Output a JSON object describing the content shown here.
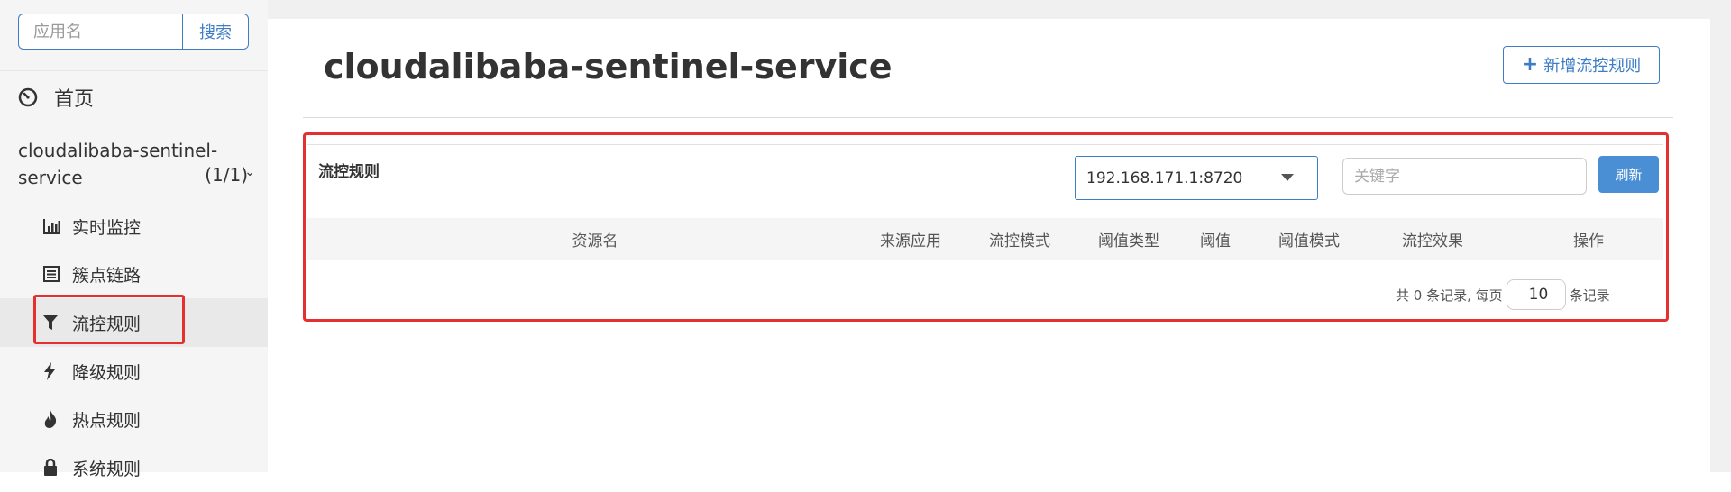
{
  "sidebar": {
    "search": {
      "placeholder": "应用名",
      "button_label": "搜索"
    },
    "home_label": "首页",
    "app": {
      "name": "cloudalibaba-sentinel-service",
      "count": "(1/1)"
    },
    "menu": [
      {
        "label": "实时监控",
        "icon": "bar-chart-icon"
      },
      {
        "label": "簇点链路",
        "icon": "list-icon"
      },
      {
        "label": "流控规则",
        "icon": "filter-icon",
        "active": true
      },
      {
        "label": "降级规则",
        "icon": "flash-icon"
      },
      {
        "label": "热点规则",
        "icon": "fire-icon"
      },
      {
        "label": "系统规则",
        "icon": "lock-icon"
      }
    ]
  },
  "main": {
    "title": "cloudalibaba-sentinel-service",
    "add_button_label": "新增流控规则",
    "panel": {
      "title": "流控规则",
      "machine_select": {
        "value": "192.168.171.1:8720"
      },
      "keyword_placeholder": "关键字",
      "refresh_label": "刷新",
      "columns": [
        "资源名",
        "来源应用",
        "流控模式",
        "阈值类型",
        "阈值",
        "阈值模式",
        "流控效果",
        "操作"
      ],
      "rows": [],
      "pagination": {
        "prefix": "共 0 条记录, 每页",
        "page_size": "10",
        "suffix": "条记录"
      }
    }
  },
  "colors": {
    "accent": "#3c7dc6",
    "highlight": "#e53030",
    "refresh_button": "#4a8fd4"
  }
}
